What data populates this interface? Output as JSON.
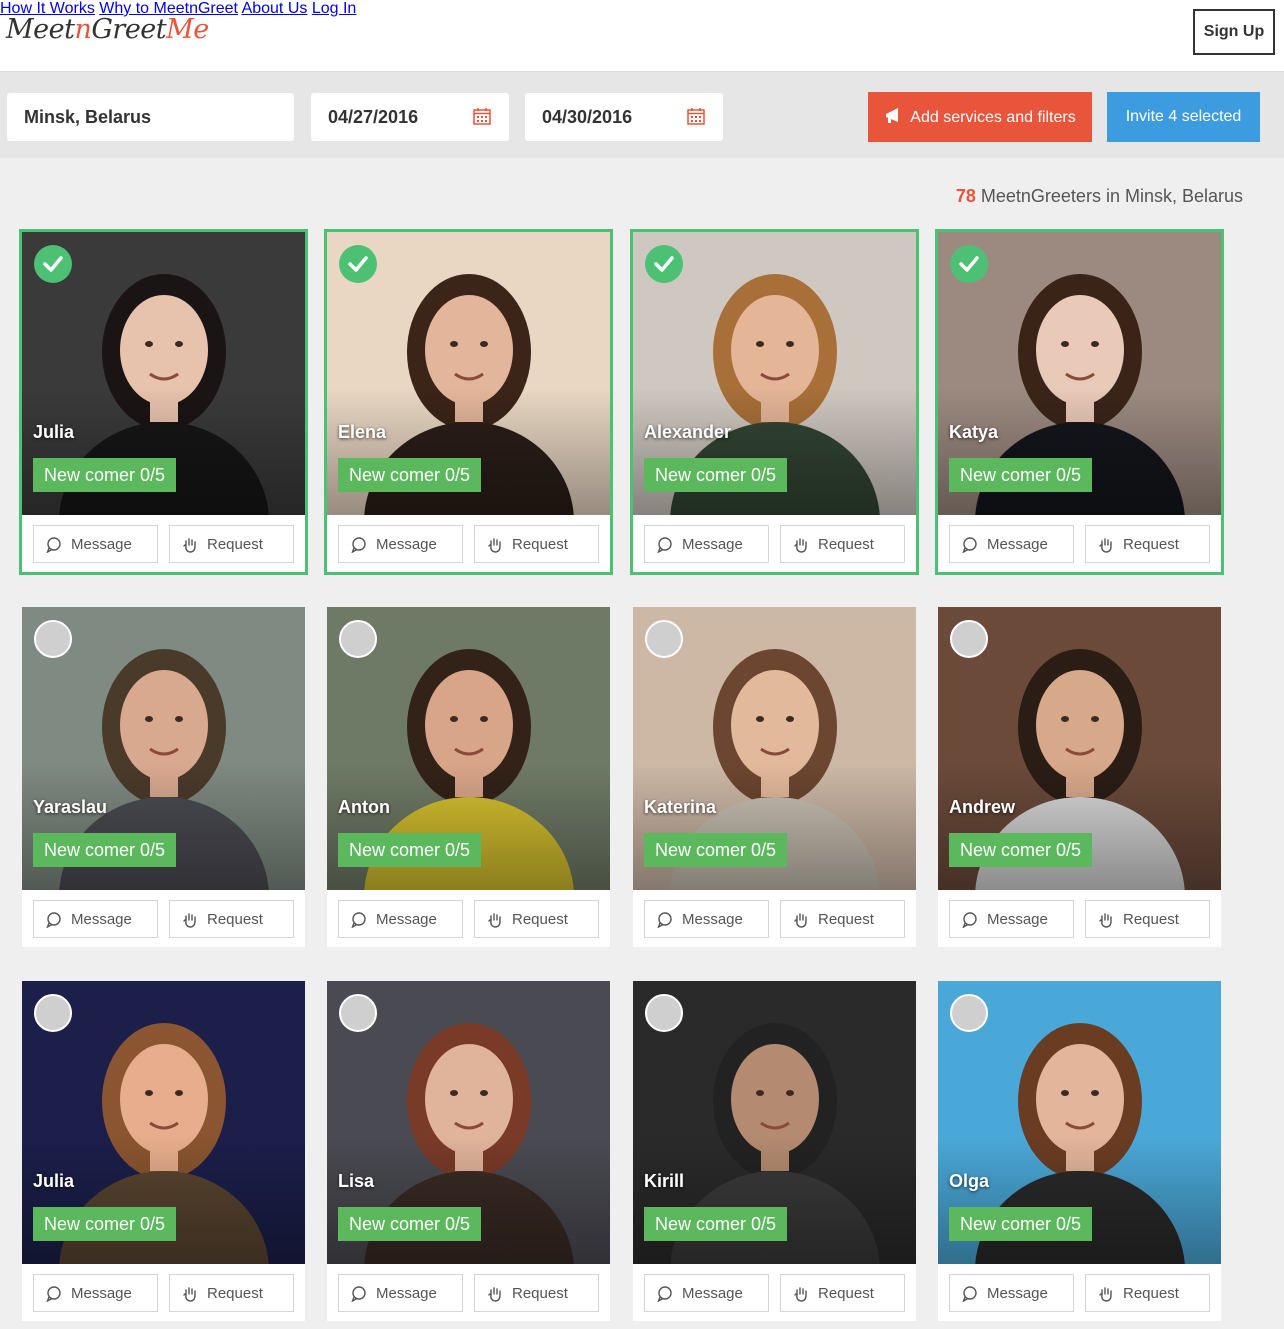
{
  "header": {
    "logo_part1": "Meet",
    "logo_part2": "n",
    "logo_part3": "Greet",
    "logo_part4": "Me",
    "nav": [
      "How It Works",
      "Why to MeetnGreet",
      "About Us",
      "Log In"
    ],
    "signup": "Sign Up"
  },
  "filters": {
    "city": "Minsk, Belarus",
    "date_from": "04/27/2016",
    "date_to": "04/30/2016",
    "add_services": "Add services and filters",
    "invite": "Invite 4 selected"
  },
  "summary": {
    "count": "78",
    "text": " MeetnGreeters in Minsk, Belarus"
  },
  "card_labels": {
    "message": "Message",
    "request": "Request"
  },
  "greeters": [
    {
      "name": "Julia",
      "badge": "New comer 0/5",
      "selected": true,
      "bg": "#3a3a3a",
      "skin": "#e7c2ad",
      "hair": "#1b1414",
      "shirt": "#161616"
    },
    {
      "name": "Elena",
      "badge": "New comer 0/5",
      "selected": true,
      "bg": "#e9d7c3",
      "skin": "#e3b69b",
      "hair": "#3b2418",
      "shirt": "#2b1e18"
    },
    {
      "name": "Alexander",
      "badge": "New comer 0/5",
      "selected": true,
      "bg": "#cfc8c0",
      "skin": "#e4b597",
      "hair": "#a86f38",
      "shirt": "#324533"
    },
    {
      "name": "Katya",
      "badge": "New comer 0/5",
      "selected": true,
      "bg": "#9c8a80",
      "skin": "#e9c9b8",
      "hair": "#3a2418",
      "shirt": "#14161c"
    },
    {
      "name": "Yaraslau",
      "badge": "New comer 0/5",
      "selected": false,
      "bg": "#7f8a82",
      "skin": "#d9a98f",
      "hair": "#4a3a2a",
      "shirt": "#4b4b53"
    },
    {
      "name": "Anton",
      "badge": "New comer 0/5",
      "selected": false,
      "bg": "#6f7a66",
      "skin": "#d9a589",
      "hair": "#322218",
      "shirt": "#d6c12e"
    },
    {
      "name": "Katerina",
      "badge": "New comer 0/5",
      "selected": false,
      "bg": "#cdb8a6",
      "skin": "#e3b99c",
      "hair": "#6c4630",
      "shirt": "#c9c1b3"
    },
    {
      "name": "Andrew",
      "badge": "New comer 0/5",
      "selected": false,
      "bg": "#6b4a3a",
      "skin": "#d8a88a",
      "hair": "#2a1d16",
      "shirt": "#d7d7d7"
    },
    {
      "name": "Julia",
      "badge": "New comer 0/5",
      "selected": false,
      "bg": "#1b1f4a",
      "skin": "#e7ad8c",
      "hair": "#8a5530",
      "shirt": "#5a4530"
    },
    {
      "name": "Lisa",
      "badge": "New comer 0/5",
      "selected": false,
      "bg": "#4a4a52",
      "skin": "#e0b39b",
      "hair": "#7a3a28",
      "shirt": "#3a2a24"
    },
    {
      "name": "Kirill",
      "badge": "New comer 0/5",
      "selected": false,
      "bg": "#2a2a2a",
      "skin": "#b48a70",
      "hair": "#222222",
      "shirt": "#3a3a3a"
    },
    {
      "name": "Olga",
      "badge": "New comer 0/5",
      "selected": false,
      "bg": "#4aa8d8",
      "skin": "#e3b59b",
      "hair": "#6a3d22",
      "shirt": "#2a2a2a"
    }
  ]
}
